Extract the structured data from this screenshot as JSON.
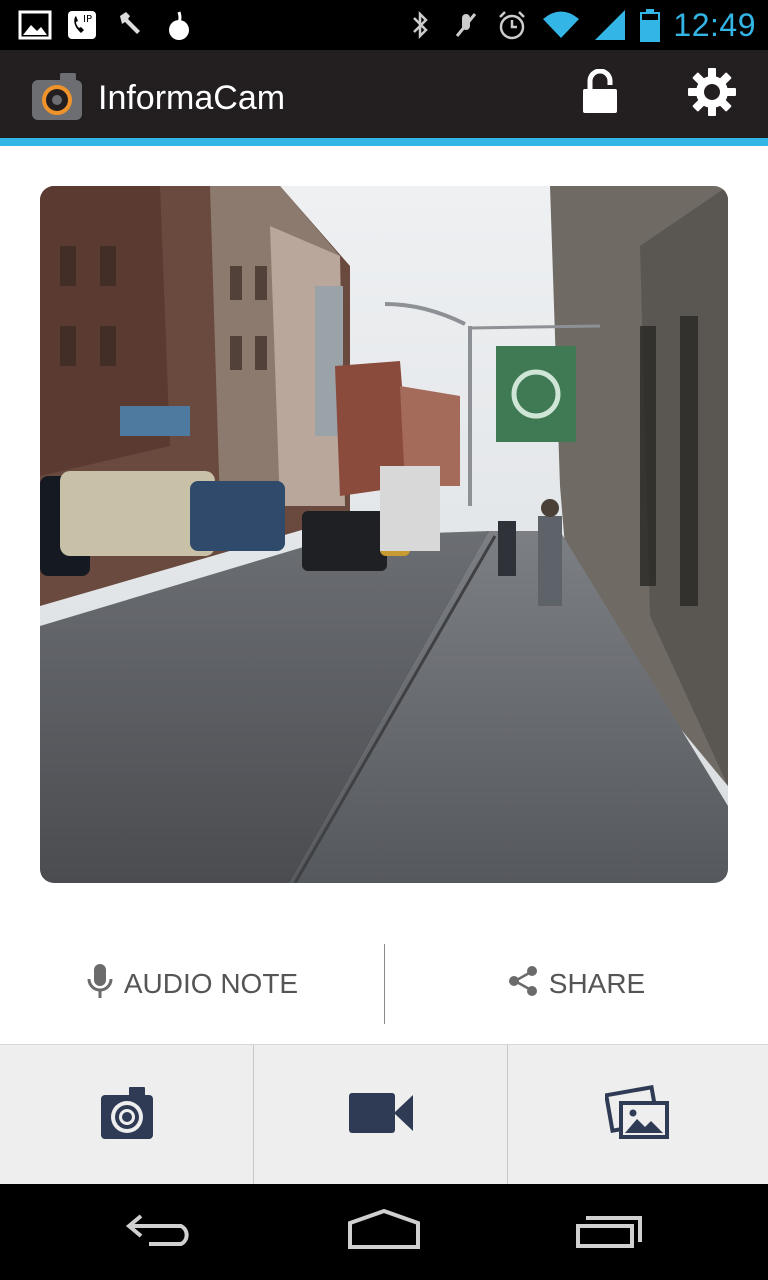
{
  "status_bar": {
    "time": "12:49",
    "icons": [
      "gallery-notification-icon",
      "voicemail-notification-icon",
      "tools-notification-icon",
      "tor-onion-icon",
      "bluetooth-icon",
      "mute-icon",
      "alarm-icon",
      "wifi-icon",
      "signal-icon",
      "battery-icon"
    ]
  },
  "action_bar": {
    "title": "InformaCam",
    "icons": [
      "app-logo-icon",
      "lock-icon",
      "gear-icon"
    ]
  },
  "media": {
    "description_icon": "street-photo-thumbnail"
  },
  "actions": {
    "audio_note_label": "AUDIO NOTE",
    "share_label": "SHARE"
  },
  "toolbar": {
    "items": [
      "camera-icon",
      "video-camera-icon",
      "gallery-icon"
    ]
  },
  "nav": {
    "items": [
      "back-icon",
      "home-icon",
      "recent-apps-icon"
    ]
  },
  "colors": {
    "accent": "#33b5e5",
    "action_bar_bg": "#231f20",
    "toolbar_icon": "#2f3b55",
    "toolbar_bg": "#eeeeee"
  }
}
